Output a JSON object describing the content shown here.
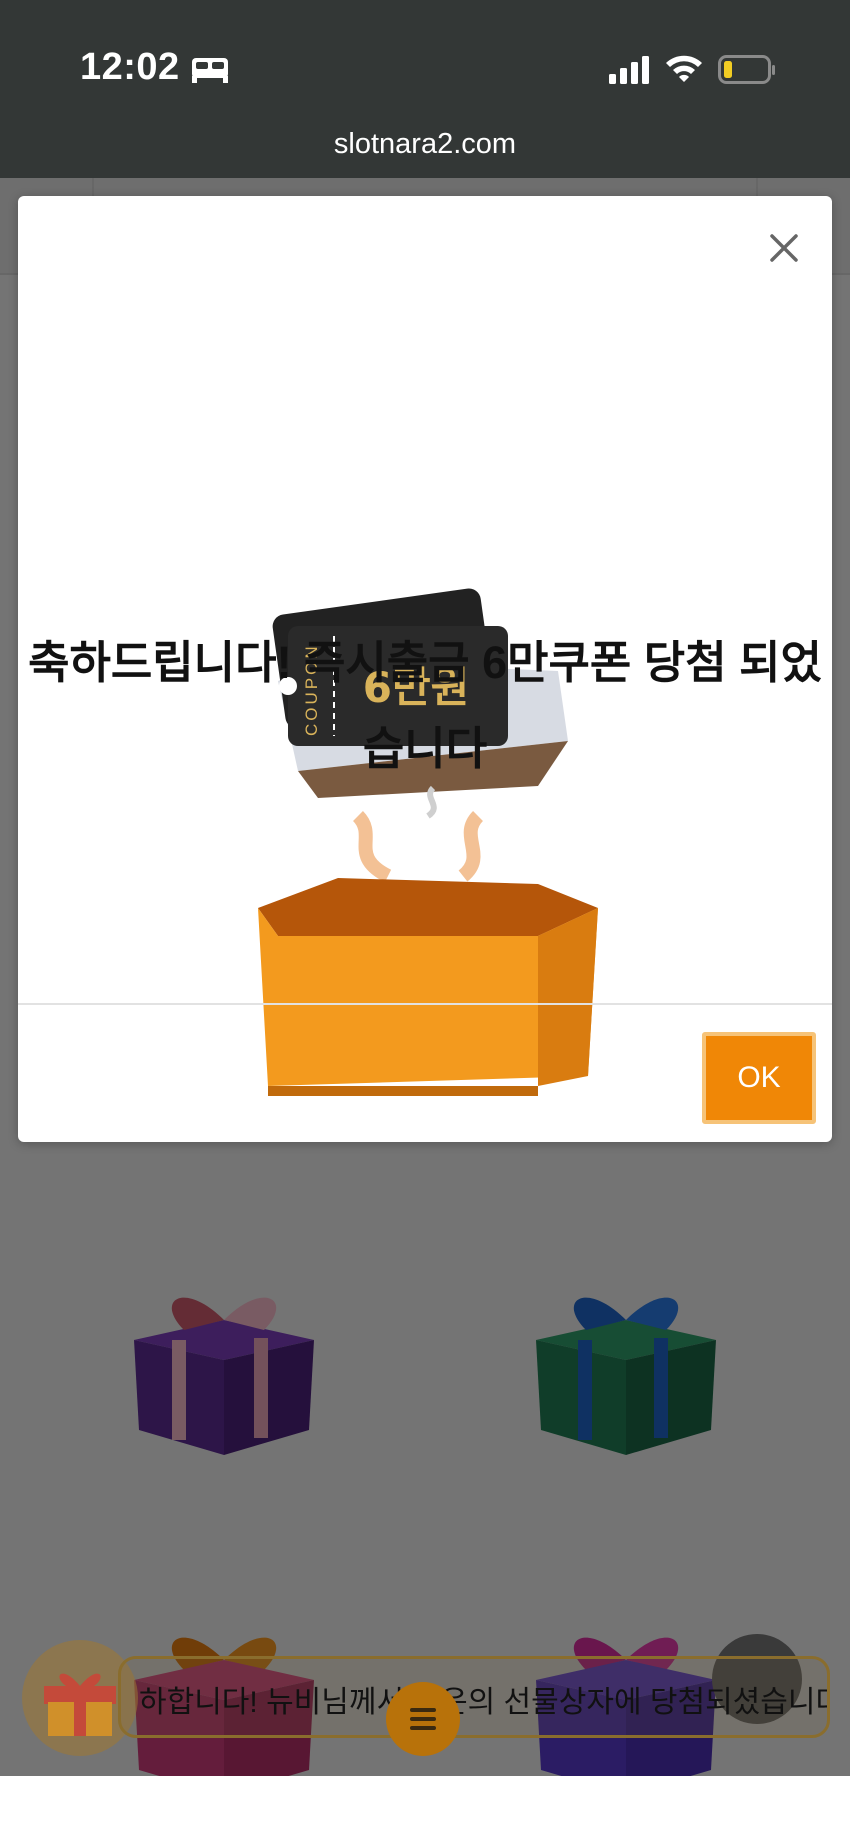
{
  "status_bar": {
    "time": "12:02",
    "icons": [
      "sleep-icon",
      "signal-icon",
      "wifi-icon",
      "battery-icon"
    ]
  },
  "browser": {
    "url": "slotnara2.com"
  },
  "modal": {
    "message_line1": "축하드립니다! 즉시출금 6만쿠폰 당첨 되었",
    "message_line2": "습니다",
    "coupon_label": "COUPON",
    "coupon_amount": "6만원",
    "ok_label": "OK",
    "close_icon": "close-icon"
  },
  "ticker": {
    "text": "하합니다! 뉴비님께서 행운의 선물상자에 당첨되셨습니다! "
  },
  "colors": {
    "accent": "#f08706",
    "status_bar_bg": "#333736",
    "overlay": "rgba(0,0,0,0.5)"
  }
}
